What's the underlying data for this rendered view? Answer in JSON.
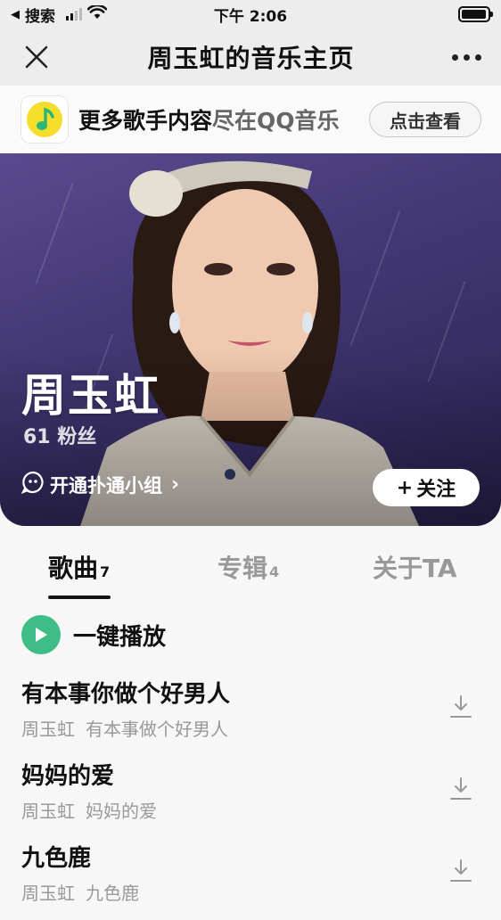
{
  "status_bar": {
    "back_app": "搜索",
    "time": "下午 2:06",
    "battery_level": 0.95
  },
  "nav": {
    "title": "周玉虹的音乐主页"
  },
  "promo": {
    "text_primary": "更多歌手内容",
    "text_secondary": "尽在QQ音乐",
    "button_label": "点击查看"
  },
  "artist": {
    "name": "周玉虹",
    "fans": "61 粉丝",
    "group_link": "开通扑通小组",
    "follow_label": "关注"
  },
  "tabs": [
    {
      "label": "歌曲",
      "count": "7"
    },
    {
      "label": "专辑",
      "count": "4"
    },
    {
      "label": "关于TA",
      "count": ""
    }
  ],
  "play_all": {
    "label": "一键播放"
  },
  "songs": [
    {
      "title": "有本事你做个好男人",
      "artist": "周玉虹",
      "album": "有本事做个好男人"
    },
    {
      "title": "妈妈的爱",
      "artist": "周玉虹",
      "album": "妈妈的爱"
    },
    {
      "title": "九色鹿",
      "artist": "周玉虹",
      "album": "九色鹿"
    }
  ],
  "colors": {
    "accent_green": "#3ebd86",
    "qq_yellow": "#f5dd2c",
    "hero_purple": "#453a78"
  }
}
